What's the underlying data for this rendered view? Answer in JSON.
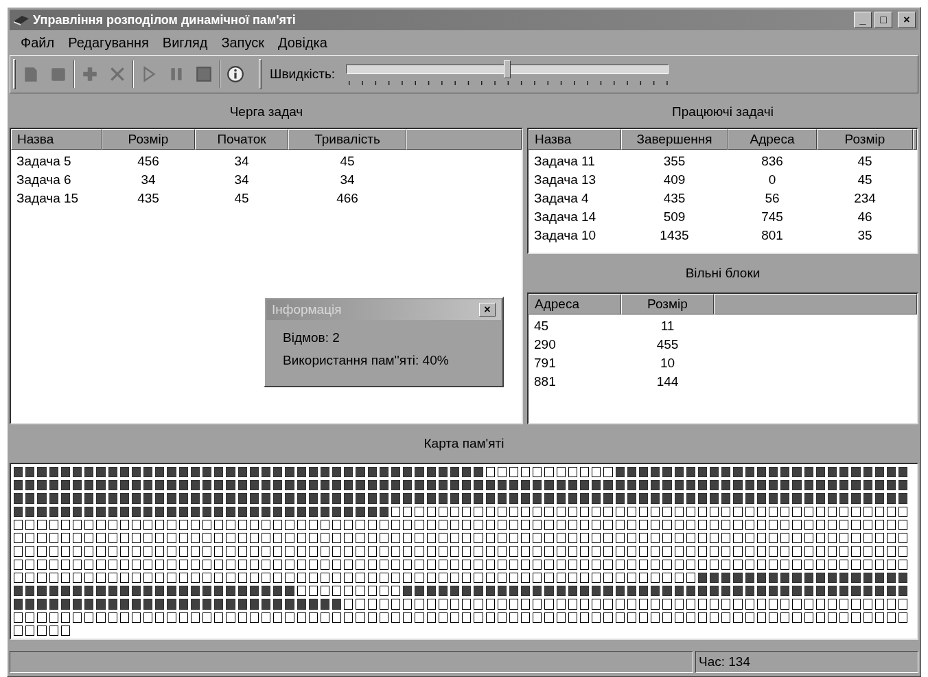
{
  "window": {
    "title": "Управління розподілом динамічної пам'яті",
    "controls": [
      "_",
      "□",
      "×"
    ]
  },
  "menu": [
    {
      "label": "Файл"
    },
    {
      "label": "Редагування"
    },
    {
      "label": "Вигляд"
    },
    {
      "label": "Запуск"
    },
    {
      "label": "Довідка"
    }
  ],
  "toolbar": {
    "buttons": [
      {
        "kind": "new",
        "disabled": true
      },
      {
        "kind": "stop-square",
        "disabled": true
      },
      {
        "kind": "separator"
      },
      {
        "kind": "add",
        "disabled": true
      },
      {
        "kind": "delete",
        "disabled": true
      },
      {
        "kind": "separator"
      },
      {
        "kind": "play",
        "disabled": true
      },
      {
        "kind": "pause",
        "disabled": true
      },
      {
        "kind": "stop",
        "disabled": true
      },
      {
        "kind": "separator"
      },
      {
        "kind": "info",
        "disabled": false
      }
    ],
    "speed": {
      "label": "Швидкість:",
      "level": 0.5
    }
  },
  "queue": {
    "title": "Черга задач",
    "columns": [
      "Назва",
      "Розмір",
      "Початок",
      "Тривалість"
    ],
    "rows": [
      [
        "Задача 5",
        "456",
        "34",
        "45"
      ],
      [
        "Задача 6",
        "34",
        "34",
        "34"
      ],
      [
        "Задача 15",
        "435",
        "45",
        "466"
      ]
    ]
  },
  "running": {
    "title": "Працюючі задачі",
    "columns": [
      "Назва",
      "Завершення",
      "Адреса",
      "Розмір"
    ],
    "rows": [
      [
        "Задача 11",
        "355",
        "836",
        "45"
      ],
      [
        "Задача 13",
        "409",
        "0",
        "45"
      ],
      [
        "Задача 4",
        "435",
        "56",
        "234"
      ],
      [
        "Задача 14",
        "509",
        "745",
        "46"
      ],
      [
        "Задача 10",
        "1435",
        "801",
        "35"
      ]
    ]
  },
  "free_blocks": {
    "title": "Вільні блоки",
    "columns": [
      "Адреса",
      "Розмір"
    ],
    "rows": [
      [
        "45",
        "11"
      ],
      [
        "290",
        "455"
      ],
      [
        "791",
        "10"
      ],
      [
        "881",
        "144"
      ]
    ]
  },
  "dialog": {
    "title": "Інформація",
    "close": "×",
    "lines": [
      "Відмов: 2",
      "Використання пам''яті: 40%"
    ]
  },
  "memory_map": {
    "title": "Карта пам'яті",
    "rows": [
      {
        "cells": [
          true,
          true,
          true,
          true,
          true,
          true,
          true,
          true,
          true,
          true,
          true,
          true,
          true,
          true,
          true,
          true,
          true,
          true,
          true,
          true,
          true,
          true,
          true,
          true,
          true,
          true,
          true,
          true,
          true,
          true,
          true,
          true,
          true,
          true,
          true,
          true,
          true,
          true,
          true,
          true,
          false,
          false,
          false,
          false,
          false,
          false,
          false,
          false,
          false,
          false,
          false,
          true,
          true,
          true,
          true,
          true,
          true,
          true,
          true,
          true,
          true,
          true,
          true,
          true,
          true,
          true,
          true,
          true,
          true,
          true,
          true,
          true,
          true,
          true,
          true,
          true
        ]
      },
      {
        "cells": [
          true,
          true,
          true,
          true,
          true,
          true,
          true,
          true,
          true,
          true,
          true,
          true,
          true,
          true,
          true,
          true,
          true,
          true,
          true,
          true,
          true,
          true,
          true,
          true,
          true,
          true,
          true,
          true,
          true,
          true,
          true,
          true,
          true,
          true,
          true,
          true,
          true,
          true,
          true,
          true,
          true,
          true,
          true,
          true,
          true,
          true,
          true,
          true,
          true,
          true,
          true,
          true,
          true,
          true,
          true,
          true,
          true,
          true,
          true,
          true,
          true,
          true,
          true,
          true,
          true,
          true,
          true,
          true,
          true,
          true,
          true,
          true,
          true,
          true,
          true,
          true
        ]
      },
      {
        "cells": [
          true,
          true,
          true,
          true,
          true,
          true,
          true,
          true,
          true,
          true,
          true,
          true,
          true,
          true,
          true,
          true,
          true,
          true,
          true,
          true,
          true,
          true,
          true,
          true,
          true,
          true,
          true,
          true,
          true,
          true,
          true,
          true,
          true,
          true,
          true,
          true,
          true,
          true,
          true,
          true,
          true,
          true,
          true,
          true,
          true,
          true,
          true,
          true,
          true,
          true,
          true,
          true,
          true,
          true,
          true,
          true,
          true,
          true,
          true,
          true,
          true,
          true,
          true,
          true,
          true,
          true,
          true,
          true,
          true,
          true,
          true,
          true,
          true,
          true,
          true,
          true
        ]
      },
      {
        "cells": [
          true,
          true,
          true,
          true,
          true,
          true,
          true,
          true,
          true,
          true,
          true,
          true,
          true,
          true,
          true,
          true,
          true,
          true,
          true,
          true,
          true,
          true,
          true,
          true,
          true,
          true,
          true,
          true,
          true,
          true,
          true,
          true,
          false,
          false,
          false,
          false,
          false,
          false,
          false,
          false,
          false,
          false,
          false,
          false,
          false,
          false,
          false,
          false,
          false,
          false,
          false,
          false,
          false,
          false,
          false,
          false,
          false,
          false,
          false,
          false,
          false,
          false,
          false,
          false,
          false,
          false,
          false,
          false,
          false,
          false,
          false,
          false,
          false,
          false,
          false,
          false
        ]
      },
      {
        "cells": [
          false,
          false,
          false,
          false,
          false,
          false,
          false,
          false,
          false,
          false,
          false,
          false,
          false,
          false,
          false,
          false,
          false,
          false,
          false,
          false,
          false,
          false,
          false,
          false,
          false,
          false,
          false,
          false,
          false,
          false,
          false,
          false,
          false,
          false,
          false,
          false,
          false,
          false,
          false,
          false,
          false,
          false,
          false,
          false,
          false,
          false,
          false,
          false,
          false,
          false,
          false,
          false,
          false,
          false,
          false,
          false,
          false,
          false,
          false,
          false,
          false,
          false,
          false,
          false,
          false,
          false,
          false,
          false,
          false,
          false,
          false,
          false,
          false,
          false,
          false,
          false
        ]
      },
      {
        "cells": [
          false,
          false,
          false,
          false,
          false,
          false,
          false,
          false,
          false,
          false,
          false,
          false,
          false,
          false,
          false,
          false,
          false,
          false,
          false,
          false,
          false,
          false,
          false,
          false,
          false,
          false,
          false,
          false,
          false,
          false,
          false,
          false,
          false,
          false,
          false,
          false,
          false,
          false,
          false,
          false,
          false,
          false,
          false,
          false,
          false,
          false,
          false,
          false,
          false,
          false,
          false,
          false,
          false,
          false,
          false,
          false,
          false,
          false,
          false,
          false,
          false,
          false,
          false,
          false,
          false,
          false,
          false,
          false,
          false,
          false,
          false,
          false,
          false,
          false,
          false,
          false
        ]
      },
      {
        "cells": [
          false,
          false,
          false,
          false,
          false,
          false,
          false,
          false,
          false,
          false,
          false,
          false,
          false,
          false,
          false,
          false,
          false,
          false,
          false,
          false,
          false,
          false,
          false,
          false,
          false,
          false,
          false,
          false,
          false,
          false,
          false,
          false,
          false,
          false,
          false,
          false,
          false,
          false,
          false,
          false,
          false,
          false,
          false,
          false,
          false,
          false,
          false,
          false,
          false,
          false,
          false,
          false,
          false,
          false,
          false,
          false,
          false,
          false,
          false,
          false,
          false,
          false,
          false,
          false,
          false,
          false,
          false,
          false,
          false,
          false,
          false,
          false,
          false,
          false,
          false,
          false
        ]
      },
      {
        "cells": [
          false,
          false,
          false,
          false,
          false,
          false,
          false,
          false,
          false,
          false,
          false,
          false,
          false,
          false,
          false,
          false,
          false,
          false,
          false,
          false,
          false,
          false,
          false,
          false,
          false,
          false,
          false,
          false,
          false,
          false,
          false,
          false,
          false,
          false,
          false,
          false,
          false,
          false,
          false,
          false,
          false,
          false,
          false,
          false,
          false,
          false,
          false,
          false,
          false,
          false,
          false,
          false,
          false,
          false,
          false,
          false,
          false,
          false,
          false,
          false,
          false,
          false,
          false,
          false,
          false,
          false,
          false,
          false,
          false,
          false,
          false,
          false,
          false,
          false,
          false,
          false
        ]
      },
      {
        "cells": [
          false,
          false,
          false,
          false,
          false,
          false,
          false,
          false,
          false,
          false,
          false,
          false,
          false,
          false,
          false,
          false,
          false,
          false,
          false,
          false,
          false,
          false,
          false,
          false,
          false,
          false,
          false,
          false,
          false,
          false,
          false,
          false,
          false,
          false,
          false,
          false,
          false,
          false,
          false,
          false,
          false,
          false,
          false,
          false,
          false,
          false,
          false,
          false,
          false,
          false,
          false,
          false,
          false,
          false,
          false,
          false,
          false,
          false,
          true,
          true,
          true,
          true,
          true,
          true,
          true,
          true,
          true,
          true,
          true,
          true,
          true,
          true,
          true,
          true,
          true,
          true
        ]
      },
      {
        "cells": [
          true,
          true,
          true,
          true,
          true,
          true,
          true,
          true,
          true,
          true,
          true,
          true,
          true,
          true,
          true,
          true,
          true,
          true,
          true,
          true,
          true,
          true,
          true,
          true,
          false,
          false,
          false,
          false,
          false,
          false,
          false,
          false,
          false,
          true,
          true,
          true,
          true,
          true,
          true,
          true,
          true,
          true,
          true,
          true,
          true,
          true,
          true,
          true,
          true,
          true,
          true,
          true,
          true,
          true,
          true,
          true,
          true,
          true,
          true,
          true,
          true,
          true,
          true,
          true,
          true,
          true,
          true,
          true,
          true,
          true,
          true,
          true,
          true,
          true,
          true,
          true
        ]
      },
      {
        "cells": [
          true,
          true,
          true,
          true,
          true,
          true,
          true,
          true,
          true,
          true,
          true,
          true,
          true,
          true,
          true,
          true,
          true,
          true,
          true,
          true,
          true,
          true,
          true,
          true,
          true,
          true,
          true,
          true,
          false,
          false,
          false,
          false,
          false,
          false,
          false,
          false,
          false,
          false,
          false,
          false,
          false,
          false,
          false,
          false,
          false,
          false,
          false,
          false,
          false,
          false,
          false,
          false,
          false,
          false,
          false,
          false,
          false,
          false,
          false,
          false,
          false,
          false,
          false,
          false,
          false,
          false,
          false,
          false,
          false,
          false,
          false,
          false,
          false,
          false,
          false,
          false
        ]
      },
      {
        "cells": [
          false,
          false,
          false,
          false,
          false,
          false,
          false,
          false,
          false,
          false,
          false,
          false,
          false,
          false,
          false,
          false,
          false,
          false,
          false,
          false,
          false,
          false,
          false,
          false,
          false,
          false,
          false,
          false,
          false,
          false,
          false,
          false,
          false,
          false,
          false,
          false,
          false,
          false,
          false,
          false,
          false,
          false,
          false,
          false,
          false,
          false,
          false,
          false,
          false,
          false,
          false,
          false,
          false,
          false,
          false,
          false,
          false,
          false,
          false,
          false,
          false,
          false,
          false,
          false,
          false,
          false,
          false,
          false,
          false,
          false,
          false,
          false,
          false,
          false,
          false,
          false
        ]
      },
      {
        "cells": [
          false,
          false,
          false,
          false,
          false
        ]
      }
    ]
  },
  "status_bar": {
    "time": "Час: 134"
  }
}
